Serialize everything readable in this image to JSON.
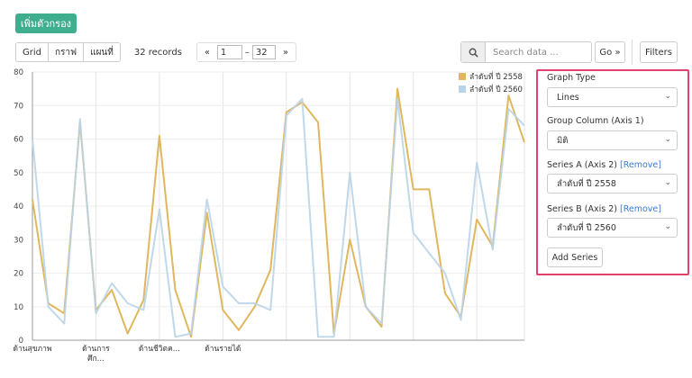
{
  "add_filter_label": "เพิ่มตัวกรอง",
  "view_tabs": [
    "Grid",
    "กราฟ",
    "แผนที่"
  ],
  "records_label": "32 records",
  "pager": {
    "prev": "«",
    "from": "1",
    "dash": "–",
    "to": "32",
    "next": "»"
  },
  "search": {
    "placeholder": "Search data ...",
    "icon": "search-icon"
  },
  "go_label": "Go »",
  "filters_label": "Filters",
  "config": {
    "graph_type_label": "Graph Type",
    "graph_type_value": "Lines",
    "group_column_label": "Group Column (Axis 1)",
    "group_column_value": "มิติ",
    "series_a_label": "Series A (Axis 2)",
    "series_a_remove": "[Remove]",
    "series_a_value": "ลำดับที่ ปี 2558",
    "series_b_label": "Series B (Axis 2)",
    "series_b_remove": "[Remove]",
    "series_b_value": "ลำดับที่ ปี 2560",
    "add_series_label": "Add Series",
    "chevron": "⌄"
  },
  "chart_data": {
    "type": "line",
    "ylim": [
      0,
      80
    ],
    "yticks": [
      0,
      10,
      20,
      30,
      40,
      50,
      60,
      70,
      80
    ],
    "xtick_labels": [
      {
        "index": 0,
        "lines": [
          "ด้านสุขภาพ"
        ]
      },
      {
        "index": 4,
        "lines": [
          "ด้านการ",
          "ศึก..."
        ]
      },
      {
        "index": 8,
        "lines": [
          "ด้านชีวิตค..."
        ]
      },
      {
        "index": 12,
        "lines": [
          "ด้านรายได้"
        ]
      }
    ],
    "legend_position": "top-right",
    "series": [
      {
        "name": "ลำดับที่ ปี 2558",
        "color": "#e0b75e",
        "values": [
          42,
          11,
          8,
          65,
          9,
          15,
          2,
          12,
          61,
          15,
          1,
          38,
          9,
          3,
          10,
          21,
          68,
          71,
          65,
          2,
          30,
          10,
          4,
          75,
          45,
          45,
          14,
          7,
          36,
          28,
          73,
          59
        ]
      },
      {
        "name": "ลำดับที่ ปี 2560",
        "color": "#b9d4e8",
        "values": [
          60,
          10,
          5,
          66,
          8,
          17,
          11,
          9,
          39,
          1,
          2,
          42,
          16,
          11,
          11,
          9,
          67,
          72,
          1,
          1,
          50,
          10,
          5,
          72,
          32,
          26,
          20,
          6,
          53,
          27,
          69,
          64
        ]
      }
    ]
  }
}
